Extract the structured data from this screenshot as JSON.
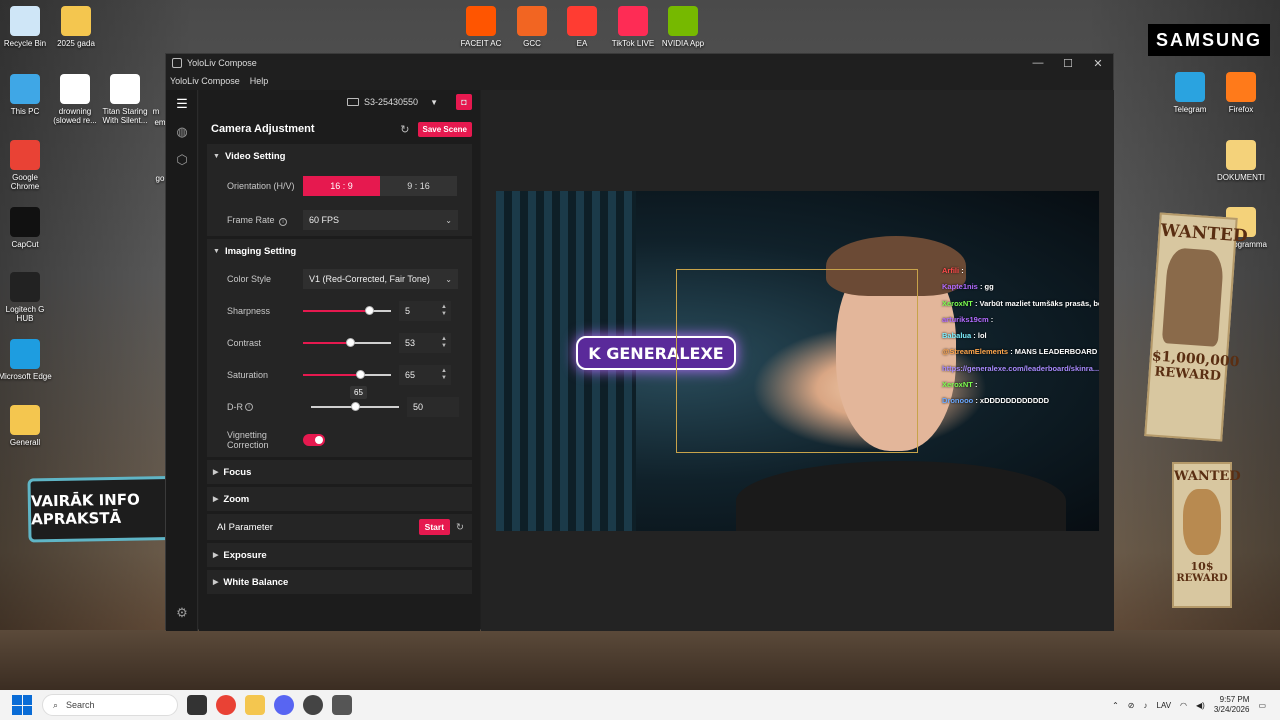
{
  "desktop": {
    "left_icons": [
      {
        "label": "Recycle Bin",
        "icon": "recycle-bin-icon",
        "color": "#cfe6f7"
      },
      {
        "label": "2025 gada",
        "icon": "folder-icon",
        "color": "#f4c64f"
      },
      {
        "label": "This PC",
        "icon": "computer-icon",
        "color": "#3fa7e6"
      },
      {
        "label": "drowning (slowed re...",
        "icon": "video-file-icon",
        "color": "#ffffff"
      },
      {
        "label": "Titan Staring With Silent...",
        "icon": "video-file-icon",
        "color": "#ffffff"
      },
      {
        "label": "Google Chrome",
        "icon": "chrome-icon",
        "color": "#e94235"
      },
      {
        "label": "CapCut",
        "icon": "capcut-icon",
        "color": "#111111"
      },
      {
        "label": "Logitech G HUB",
        "icon": "logitech-icon",
        "color": "#222222"
      },
      {
        "label": "Microsoft Edge",
        "icon": "edge-icon",
        "color": "#1e9de0"
      },
      {
        "label": "Generall",
        "icon": "folder-icon",
        "color": "#f4c64f"
      }
    ],
    "partial_labels": [
      "m",
      "em",
      "go"
    ],
    "top_icons": [
      {
        "label": "FACEIT AC",
        "icon": "faceit-icon",
        "color": "#ff5500"
      },
      {
        "label": "GCC",
        "icon": "gcc-icon",
        "color": "#f26522"
      },
      {
        "label": "EA",
        "icon": "ea-icon",
        "color": "#ff3c32"
      },
      {
        "label": "TikTok LIVE",
        "icon": "tiktok-icon",
        "color": "#fe2c55"
      },
      {
        "label": "NVIDIA App",
        "icon": "nvidia-icon",
        "color": "#76b900"
      }
    ],
    "right_icons": [
      {
        "label": "Telegram",
        "icon": "telegram-icon",
        "color": "#2aa3e0"
      },
      {
        "label": "Firefox",
        "icon": "firefox-icon",
        "color": "#ff7a1a"
      },
      {
        "label": "DOKUMENTI",
        "icon": "folder-icon",
        "color": "#f4d27a"
      },
      {
        "label": "uri programma",
        "icon": "folder-icon",
        "color": "#f4d27a"
      }
    ],
    "samsung": "SAMSUNG",
    "posters": [
      {
        "line1": "WANTED",
        "line2": "$1,000,000",
        "line3": "REWARD"
      },
      {
        "line1": "WANTED",
        "line2": "10$",
        "line3": "REWARD"
      }
    ],
    "promo": "VAIRĀK INFO APRAKSTĀ"
  },
  "window": {
    "title": "YoloLiv Compose",
    "menu": [
      "YoloLiv Compose",
      "Help"
    ],
    "controls": {
      "minimize": "—",
      "maximize": "☐",
      "close": "✕"
    }
  },
  "device": {
    "name": "S3-25430550"
  },
  "camera_adjustment": {
    "title": "Camera Adjustment",
    "save_label": "Save Scene",
    "video_setting": {
      "title": "Video Setting",
      "orientation_label": "Orientation (H/V)",
      "orientation_options": [
        "16 : 9",
        "9 : 16"
      ],
      "orientation_selected": 0,
      "frame_rate_label": "Frame Rate",
      "frame_rate_value": "60 FPS"
    },
    "imaging_setting": {
      "title": "Imaging Setting",
      "color_style_label": "Color Style",
      "color_style_value": "V1 (Red-Corrected, Fair Tone)",
      "sliders": [
        {
          "label": "Sharpness",
          "value": "5",
          "fraction": 0.75,
          "red": true
        },
        {
          "label": "Contrast",
          "value": "53",
          "fraction": 0.53,
          "red": true
        },
        {
          "label": "Saturation",
          "value": "65",
          "fraction": 0.65,
          "red": true
        },
        {
          "label": "D-R",
          "value": "50",
          "fraction": 0.5,
          "red": false
        }
      ],
      "tooltip": "65",
      "vignetting_label": "Vignetting Correction",
      "vignetting_on": true
    },
    "collapsed_sections": [
      "Focus",
      "Zoom"
    ],
    "ai_parameter": {
      "label": "AI Parameter",
      "start_label": "Start"
    },
    "more_sections": [
      "Exposure",
      "White Balance"
    ]
  },
  "preview": {
    "neon_text": "K GENERALEXE",
    "chat": [
      {
        "user": "Arfili",
        "text": ":",
        "color": "#ff4b4b"
      },
      {
        "user": "Kapte1nis",
        "text": ": gg",
        "color": "#b36bff"
      },
      {
        "user": "XeroxNT",
        "text": ": Varbūt mazliet tumšāks prasās, bet ta ir norm.",
        "color": "#7dff4f"
      },
      {
        "user": "arturiks19cm",
        "text": ":",
        "color": "#b36bff"
      },
      {
        "user": "Babalua",
        "text": ": lol",
        "color": "#7df0ff"
      },
      {
        "user": "@StreamElements",
        "text": ": MANS LEADERBOARD",
        "color": "#ffa64d"
      },
      {
        "user": "https://generalexe.com/leaderboard/skinra...",
        "text": "",
        "color": "#a98bff"
      },
      {
        "user": "XeroxNT",
        "text": ":",
        "color": "#7dff4f"
      },
      {
        "user": "Dronooo",
        "text": ": xDDDDDDDDDDDD",
        "color": "#6aa8ff"
      }
    ]
  },
  "taskbar": {
    "search_placeholder": "Search",
    "language": "LAV",
    "time": "9:57 PM",
    "date": "3/24/2026"
  }
}
